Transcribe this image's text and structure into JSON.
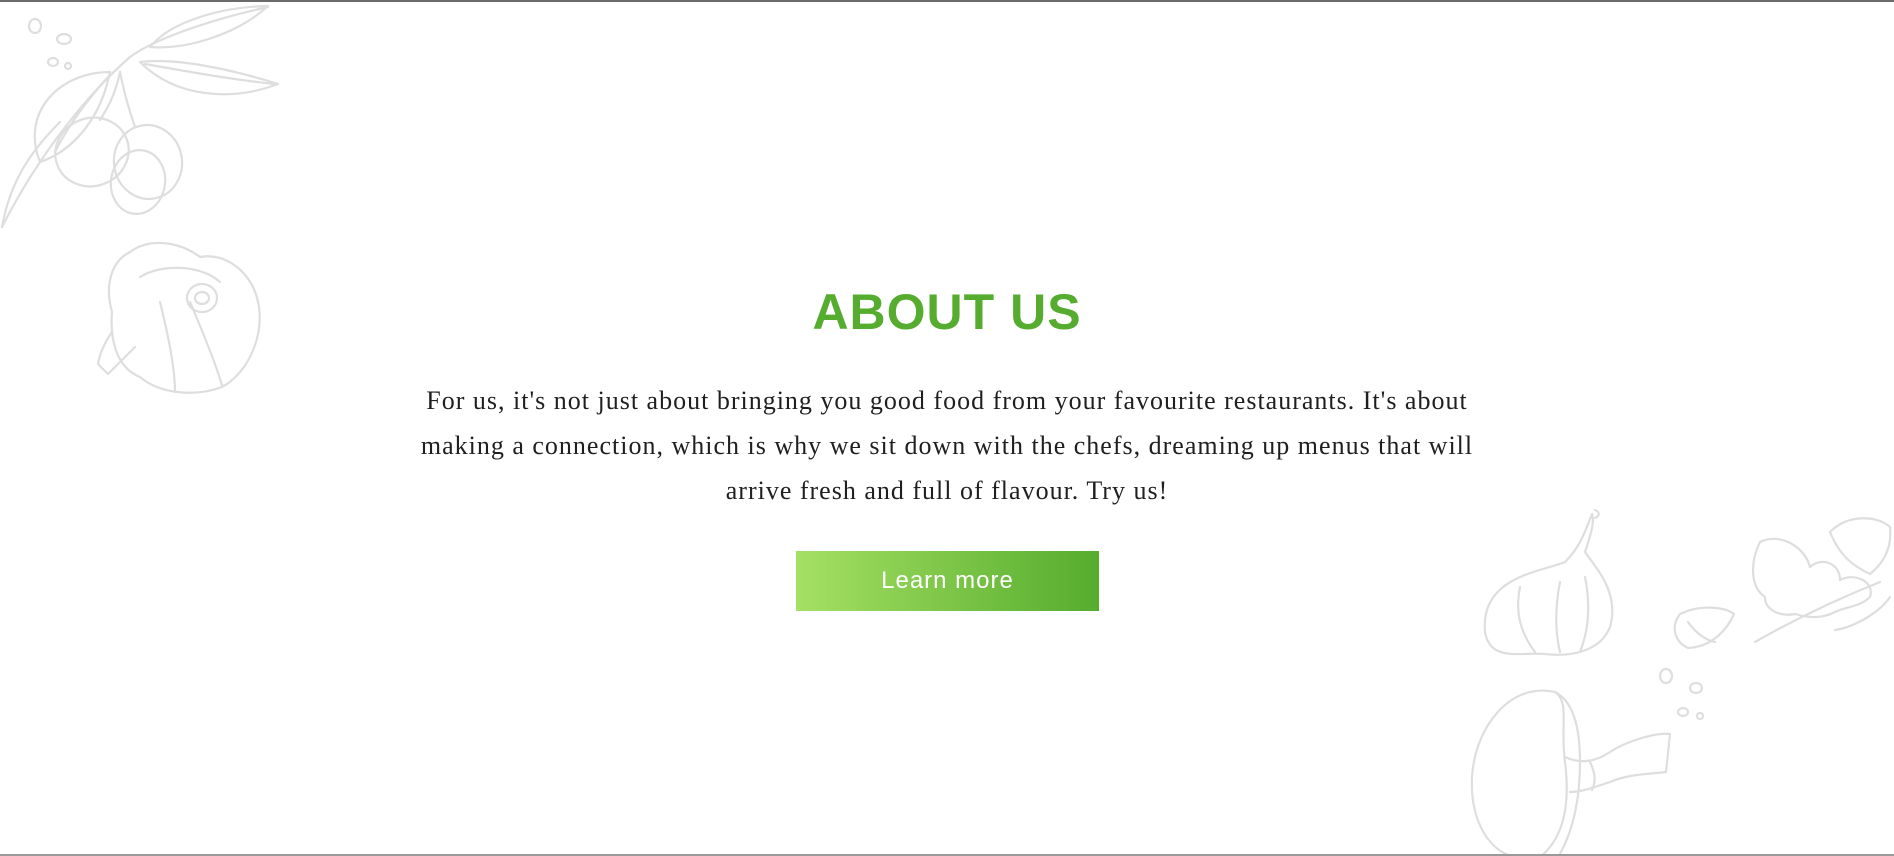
{
  "about": {
    "title": "ABOUT US",
    "body": "For us, it's not just about bringing you good food from your favourite restaurants. It's about making a connection, which is why we sit down with the chefs, dreaming up menus that will arrive fresh and full of flavour. Try us!",
    "button_label": "Learn more"
  },
  "colors": {
    "accent": "#55ac2e",
    "button_gradient_start": "#a5e063",
    "button_gradient_end": "#55ac2e",
    "illustration_stroke": "#dedede",
    "body_text": "#1f1f1f"
  },
  "decorations": {
    "top_left": [
      "olive-branch-icon",
      "pumpkin-icon"
    ],
    "bottom_right": [
      "garlic-icon",
      "garlic-clove-icon",
      "parsley-icon",
      "mushroom-icon",
      "seeds-icon"
    ]
  }
}
